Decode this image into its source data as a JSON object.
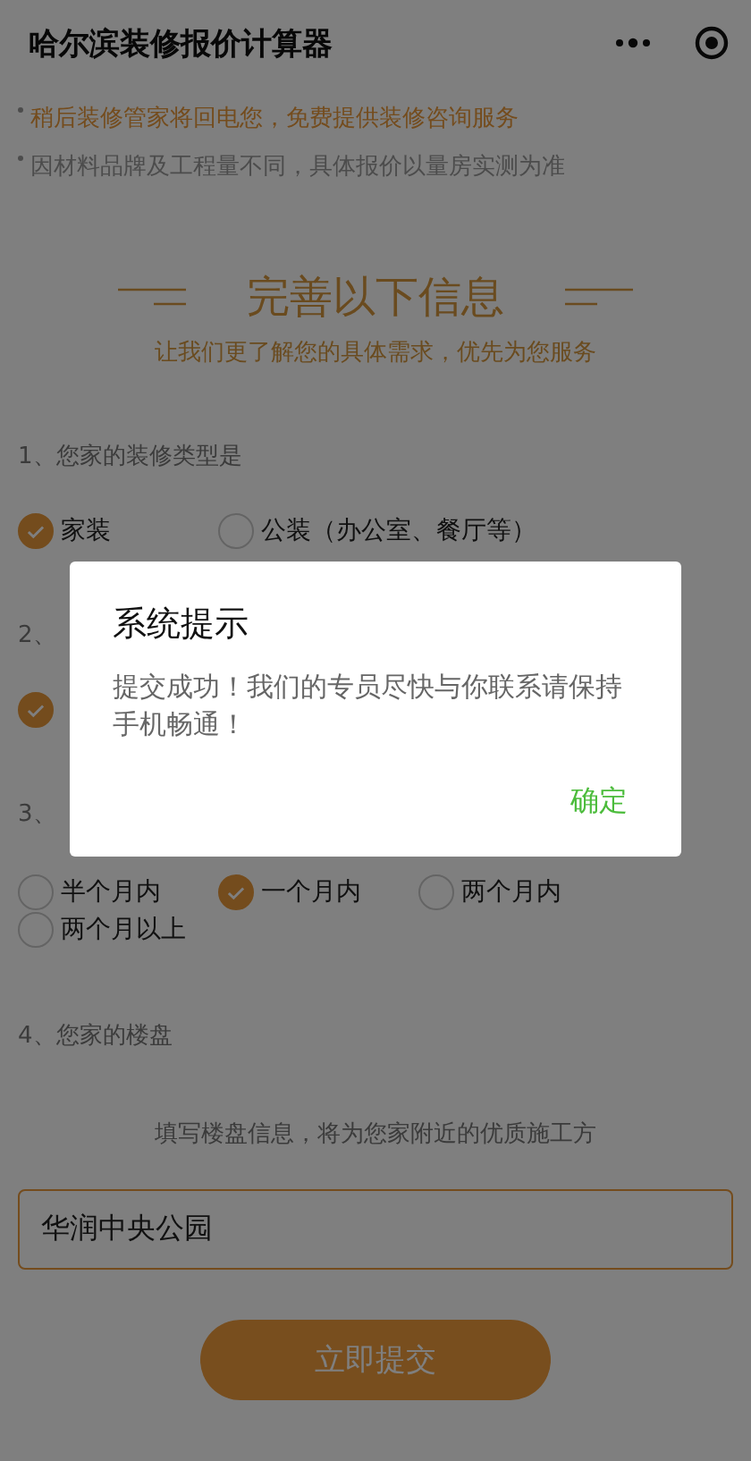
{
  "nav": {
    "title": "哈尔滨装修报价计算器"
  },
  "notes": [
    {
      "text": "稍后装修管家将回电您，免费提供装修咨询服务",
      "kind": "highlight"
    },
    {
      "text": "因材料品牌及工程量不同，具体报价以量房实测为准",
      "kind": "plain"
    }
  ],
  "header": {
    "title": "完善以下信息",
    "subtitle": "让我们更了解您的具体需求，优先为您服务"
  },
  "sections": [
    {
      "label": "1、您家的装修类型是",
      "options": [
        {
          "label": "家装",
          "selected": true
        },
        {
          "label": "公装（办公室、餐厅等）",
          "selected": false
        }
      ]
    },
    {
      "label": "2、",
      "options": [
        {
          "selected": true
        }
      ]
    },
    {
      "label": "3、",
      "options": [
        {
          "label": "半个月内",
          "selected": false
        },
        {
          "label": "一个月内",
          "selected": true
        },
        {
          "label": "两个月内",
          "selected": false
        },
        {
          "label": "两个月以上",
          "selected": false
        }
      ]
    },
    {
      "label": "4、您家的楼盘",
      "hint": "填写楼盘信息，将为您家附近的优质施工方",
      "field": {
        "value": "华润中央公园"
      }
    }
  ],
  "submit": "立即提交",
  "dialog": {
    "title": "系统提示",
    "message": "提交成功！我们的专员尽快与你联系请保持手机畅通！",
    "confirm": "确定"
  }
}
